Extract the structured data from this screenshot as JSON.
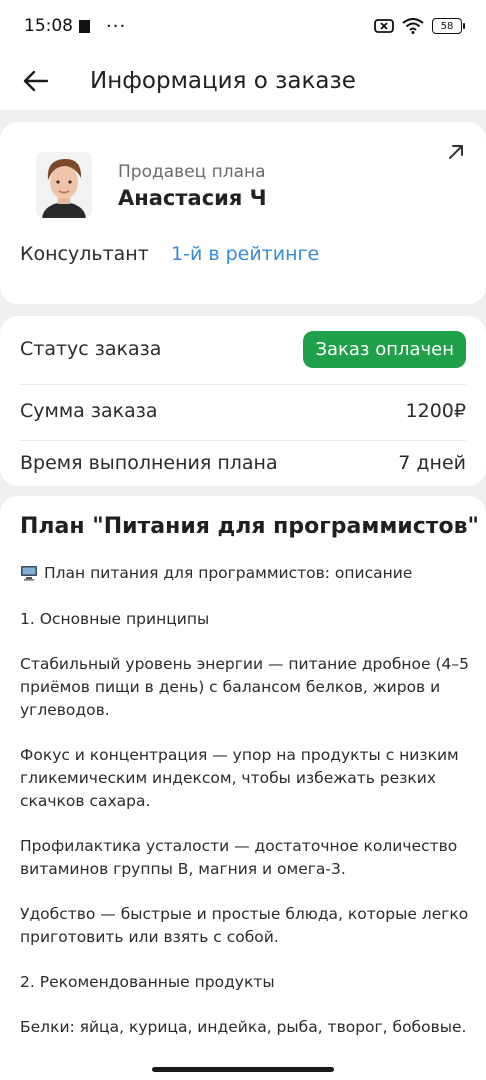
{
  "status_bar": {
    "time": "15:08",
    "dots": "···",
    "battery": "58"
  },
  "app_bar": {
    "title": "Информация о заказе"
  },
  "seller": {
    "label": "Продавец плана",
    "name": "Анастасия Ч",
    "consultant_label": "Консультант",
    "consultant_rank": "1-й в рейтинге"
  },
  "order": {
    "status_label": "Статус заказа",
    "status_value": "Заказ оплачен",
    "sum_label": "Сумма заказа",
    "sum_value": "1200₽",
    "time_label": "Время выполнения плана",
    "time_value": "7 дней"
  },
  "plan": {
    "title": "План \"Питания для программистов\"",
    "paragraphs": [
      "План питания для программистов: описание",
      "1. Основные принципы",
      "Стабильный уровень энергии — питание дробное (4–5 приёмов пищи в день) с балансом белков, жиров и углеводов.",
      "Фокус и концентрация — упор на продукты с низким гликемическим индексом, чтобы избежать резких скачков сахара.",
      "Профилактика усталости — достаточное количество витаминов группы B, магния и омега-3.",
      "Удобство — быстрые и простые блюда, которые легко приготовить или взять с собой.",
      "2. Рекомендованные продукты",
      "Белки: яйца, курица, индейка, рыба, творог, бобовые."
    ]
  },
  "colors": {
    "accent_blue": "#3a8bd6",
    "status_green": "#1fa14a"
  }
}
